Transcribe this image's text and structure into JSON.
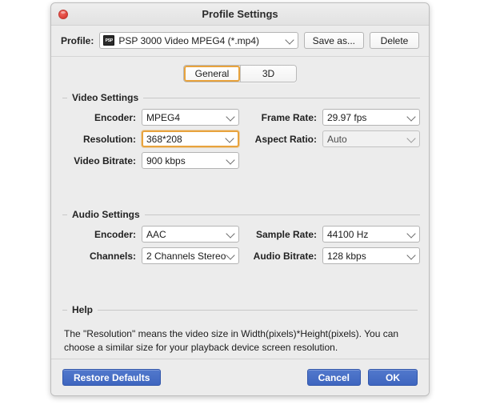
{
  "window": {
    "title": "Profile Settings",
    "close_icon": "close-icon"
  },
  "profile": {
    "label": "Profile:",
    "icon": "psp-device-icon",
    "icon_text": "PSP",
    "value": "PSP 3000 Video MPEG4 (*.mp4)",
    "save_as_label": "Save as...",
    "delete_label": "Delete"
  },
  "tabs": [
    {
      "label": "General",
      "active": true
    },
    {
      "label": "3D",
      "active": false
    }
  ],
  "video_settings": {
    "legend": "Video Settings",
    "encoder_label": "Encoder:",
    "encoder_value": "MPEG4",
    "frame_rate_label": "Frame Rate:",
    "frame_rate_value": "29.97 fps",
    "resolution_label": "Resolution:",
    "resolution_value": "368*208",
    "aspect_ratio_label": "Aspect Ratio:",
    "aspect_ratio_value": "Auto",
    "video_bitrate_label": "Video Bitrate:",
    "video_bitrate_value": "900 kbps"
  },
  "audio_settings": {
    "legend": "Audio Settings",
    "encoder_label": "Encoder:",
    "encoder_value": "AAC",
    "sample_rate_label": "Sample Rate:",
    "sample_rate_value": "44100 Hz",
    "channels_label": "Channels:",
    "channels_value": "2 Channels Stereo",
    "audio_bitrate_label": "Audio Bitrate:",
    "audio_bitrate_value": "128 kbps"
  },
  "help": {
    "legend": "Help",
    "text": "The \"Resolution\" means the video size in Width(pixels)*Height(pixels).  You can choose a similar size for your playback device screen resolution."
  },
  "footer": {
    "restore_defaults_label": "Restore Defaults",
    "cancel_label": "Cancel",
    "ok_label": "OK"
  },
  "colors": {
    "accent_focus": "#e8a33d",
    "button_blue": "#4a6ec5",
    "window_bg": "#ececec",
    "close_red": "#e0443c"
  }
}
